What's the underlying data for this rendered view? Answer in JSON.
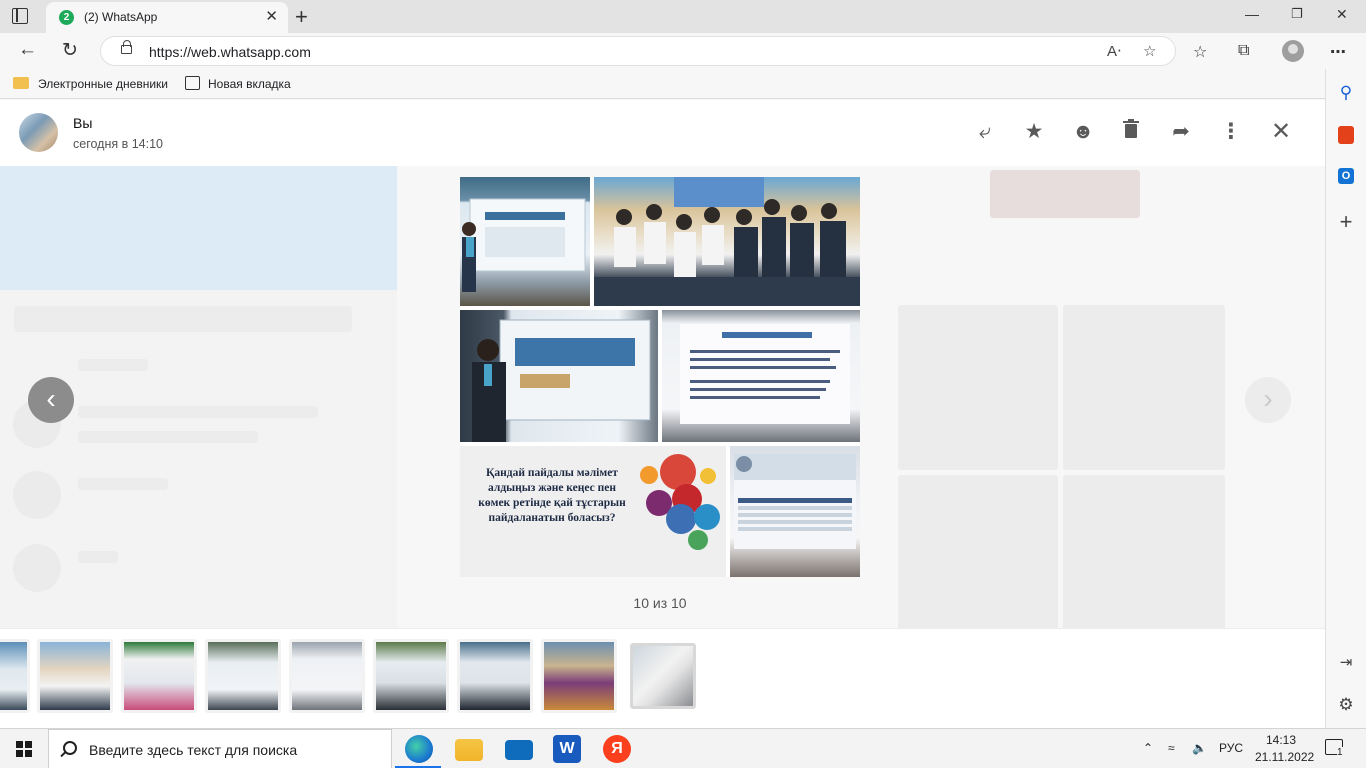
{
  "browser": {
    "tab_badge": "2",
    "tab_title": "(2) WhatsApp",
    "tab_close": "✕",
    "new_tab": "+",
    "url": "https://web.whatsapp.com",
    "read_aloud": "A‧",
    "bookmarks": [
      {
        "label": "Электронные дневники"
      },
      {
        "label": "Новая вкладка"
      }
    ]
  },
  "viewer": {
    "sender_name": "Вы",
    "sender_time": "сегодня в 14:10",
    "counter": "10 из 10",
    "thumbnail_count": 9
  },
  "photo5": {
    "text": "Қандай пайдалы мәлімет алдыңыз және кеңес пен көмек ретінде қай тұстарын пайдаланатын боласыз?"
  },
  "taskbar": {
    "search_placeholder": "Введите здесь текст для поиска",
    "language": "РУС",
    "time": "14:13",
    "date": "21.11.2022",
    "notification_count": "1"
  },
  "colors": {
    "accent_green": "#1eaa5a",
    "whatsapp_icons": "#5a5a5a"
  }
}
